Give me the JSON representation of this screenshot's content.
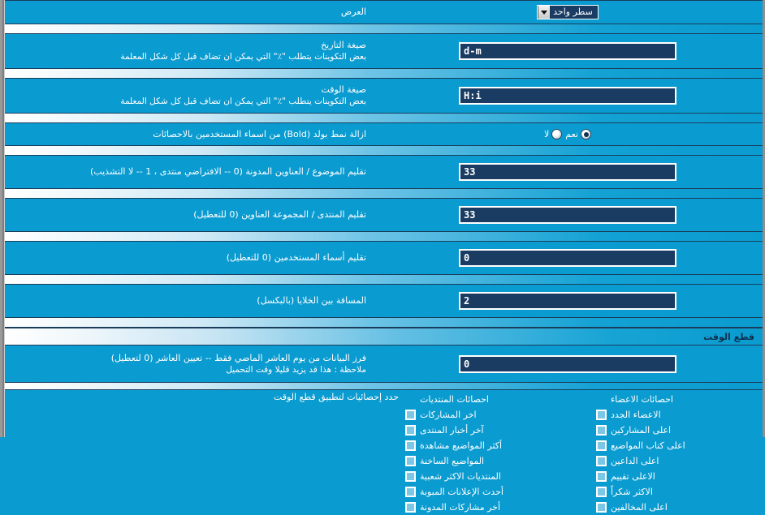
{
  "page": {
    "language": "ar",
    "direction": "rtl",
    "colors": {
      "background": "#0a9bd0",
      "input_background": "#1a3c63",
      "input_border": "#ffffff",
      "separator_line": "#1a3d5c",
      "text": "#ffffff",
      "section_title_text": "#0d2f4d",
      "checkbox_fill": "#7cc7e6"
    }
  },
  "fields": {
    "display": {
      "label": "العرض",
      "control": "select",
      "selected": "سطر واحد",
      "arrow_icon": "chevron-down-icon"
    },
    "date_format": {
      "label": "صيغة التاريخ",
      "hint": "بعض التكوينات يتطلب \"٪\" التي يمكن ان تضاف قبل كل شكل المعلمة",
      "value": "d-m"
    },
    "time_format": {
      "label": "صيغة الوقت",
      "hint": "بعض التكوينات يتطلب \"٪\" التي يمكن ان تضاف قبل كل شكل المعلمة",
      "value": "H:i"
    },
    "remove_bold": {
      "label": "ازالة نمط بولد (Bold) من اسماء المستخدمين بالاحصائات",
      "options": [
        {
          "label": "نعم",
          "selected": true
        },
        {
          "label": "لا",
          "selected": false
        }
      ]
    },
    "trim_topic_titles": {
      "label": "تقليم الموضوع / العناوين المدونة (0 -- الافتراضي منتدى ، 1 -- لا التشذيب)",
      "value": "33"
    },
    "trim_forum_titles": {
      "label": "تقليم المنتدى / المجموعة العناوين (0 للتعطيل)",
      "value": "33"
    },
    "trim_usernames": {
      "label": "تقليم أسماء المستخدمين (0 للتعطيل)",
      "value": "0"
    },
    "cell_spacing": {
      "label": "المسافة بين الخلايا (بالبكسل)",
      "value": "2"
    }
  },
  "time_cut_section": {
    "title": "قطع الوقت",
    "sort_field": {
      "label_line1": "فرز البيانات من يوم العاشر الماضي فقط -- تعيين العاشر (0 لتعطيل)",
      "label_line2": "ملاحظة : هذا قد يزيد قليلا وقت التحميل",
      "value": "0"
    },
    "apply_label": "حدد إحصائيات لتطبيق قطع الوقت",
    "forums_column": {
      "header": "احصائات المنتديات",
      "items": [
        {
          "label": "اخر المشاركات",
          "checked": false
        },
        {
          "label": "آخر أخبار المنتدى",
          "checked": false
        },
        {
          "label": "أكثر المواضيع مشاهدة",
          "checked": false
        },
        {
          "label": "المواضيع الساخنة",
          "checked": false
        },
        {
          "label": "المنتديات الاكثر شعبية",
          "checked": false
        },
        {
          "label": "أحدث الإعلانات المبوبة",
          "checked": false
        },
        {
          "label": "أخر مشاركات المدونة",
          "checked": false
        }
      ]
    },
    "members_column": {
      "header": "احصائات الاعضاء",
      "items": [
        {
          "label": "الاعضاء الجدد",
          "checked": false
        },
        {
          "label": "اعلى المشاركين",
          "checked": false
        },
        {
          "label": "اعلى كتاب المواضيع",
          "checked": false
        },
        {
          "label": "اعلى الداعين",
          "checked": false
        },
        {
          "label": "الاعلى تقييم",
          "checked": false
        },
        {
          "label": "الاكثر شكراً",
          "checked": false
        },
        {
          "label": "اعلى المخالفين",
          "checked": false
        }
      ]
    }
  }
}
